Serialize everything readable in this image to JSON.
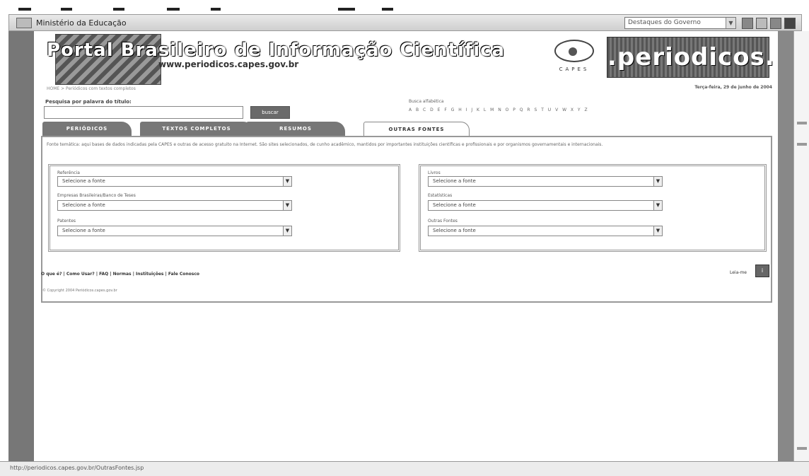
{
  "govbar": {
    "title": "Ministério da Educação",
    "select_value": "Destaques do Governo",
    "select_arrow": "▼"
  },
  "header": {
    "banner_title": "Portal Brasileiro de Informação Científica",
    "banner_url": "www.periodicos.capes.gov.br",
    "capes_label": "CAPES",
    "periodicos_logo": ".periodicos."
  },
  "breadcrumb": "HOME > Periódicos com textos completos",
  "date": "Terça-feira, 29 de junho de 2004",
  "search": {
    "label": "Pesquisa por palavra do título:",
    "value": "",
    "button": "buscar"
  },
  "busca": {
    "label": "Busca alfabética",
    "letters": "A B C D E F G H I J K L M N O P Q R S T U V W X Y Z"
  },
  "tabs": [
    {
      "label": "PERIÓDICOS",
      "active": false
    },
    {
      "label": "TEXTOS COMPLETOS",
      "active": false
    },
    {
      "label": "RESUMOS",
      "active": false
    },
    {
      "label": "OUTRAS FONTES",
      "active": true
    }
  ],
  "intro": "Fonte temática: aqui bases de dados indicadas pela CAPES e outras de acesso gratuito na Internet. São sites selecionados, de cunho acadêmico, mantidos por importantes instituições científicas e profissionais e por organismos governamentais e internacionais.",
  "left_group": [
    {
      "label": "Referência",
      "value": "Selecione a fonte"
    },
    {
      "label": "Empresas Brasileiras/Banco de Teses",
      "value": "Selecione a fonte"
    },
    {
      "label": "Patentes",
      "value": "Selecione a fonte"
    }
  ],
  "right_group": [
    {
      "label": "Livros",
      "value": "Selecione a fonte"
    },
    {
      "label": "Estatísticas",
      "value": "Selecione a fonte"
    },
    {
      "label": "Outras Fontes",
      "value": "Selecione a fonte"
    }
  ],
  "footer": {
    "links": "O que é? | Como Usar? | FAQ | Normas | Instituições | Fale Conosco",
    "copyright": "© Copyright 2004 Periódicos.capes.gov.br",
    "leia": "Leia-me",
    "leia_icon": "i"
  },
  "status_url": "http://periodicos.capes.gov.br/OutrasFontes.jsp",
  "icons": {
    "gov": "brasil-flag-icon",
    "window": [
      "home-icon",
      "help-icon",
      "flag-icon"
    ],
    "arrow": "dropdown-arrow-icon"
  }
}
